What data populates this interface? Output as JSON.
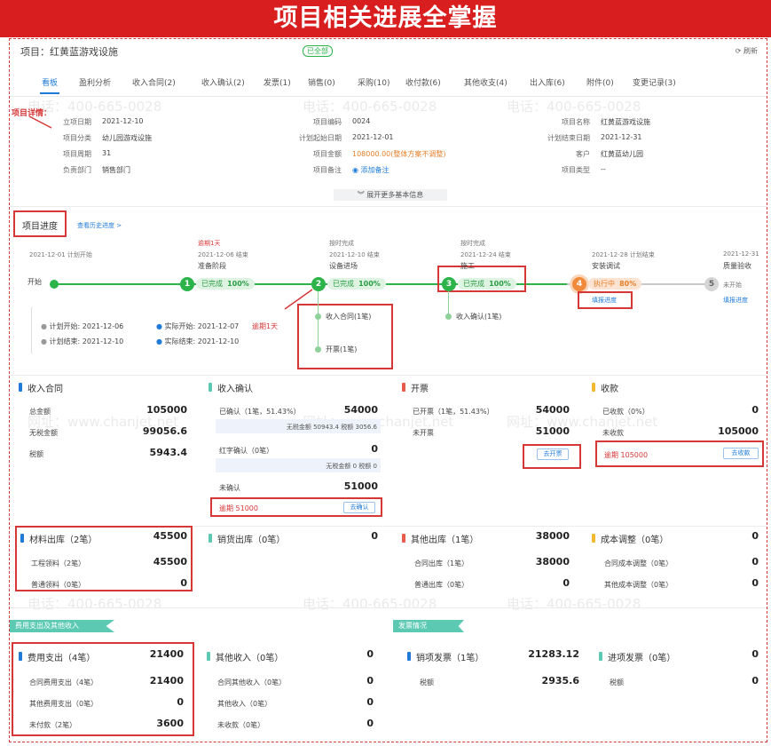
{
  "banner": "项目相关进展全掌握",
  "project": {
    "label": "项目：红黄蓝游戏设施",
    "status_tag": "已全部",
    "refresh": "刷新"
  },
  "tabs": [
    "看板",
    "盈利分析",
    "收入合同(2)",
    "收入确认(2)",
    "发票(1)",
    "销售(0)",
    "采购(10)",
    "收付款(6)",
    "其他收支(4)",
    "出入库(6)",
    "附件(0)",
    "变更记录(3)"
  ],
  "details": {
    "section_label": "项目详情：",
    "col1": [
      {
        "label": "立项日期",
        "value": "2021-12-10"
      },
      {
        "label": "项目分类",
        "value": "幼儿园游戏设施"
      },
      {
        "label": "项目周期",
        "value": "31"
      },
      {
        "label": "负责部门",
        "value": "销售部门"
      }
    ],
    "col2": [
      {
        "label": "项目编码",
        "value": "0024"
      },
      {
        "label": "计划起始日期",
        "value": "2021-12-01"
      },
      {
        "label": "项目金额",
        "value": "108000.00(整体方案不调整)"
      },
      {
        "label": "项目备注",
        "value": "◉ 添加备注"
      }
    ],
    "col3": [
      {
        "label": "项目名称",
        "value": "红黄蓝游戏设施"
      },
      {
        "label": "计划结束日期",
        "value": "2021-12-31"
      },
      {
        "label": "客户",
        "value": "红黄蓝幼儿园"
      },
      {
        "label": "项目类型",
        "value": "--"
      }
    ],
    "expand": "︾ 展开更多基本信息"
  },
  "progress": {
    "title": "项目进度",
    "history_link": "查看历史进度 >",
    "start_label": "开始",
    "start_sub": "2021-12-01 计划开始",
    "steps": [
      {
        "num": "1",
        "top": "逾期1天",
        "sub": "2021-12-06 结束",
        "name": "准备阶段",
        "status": "已完成",
        "pct": "100%"
      },
      {
        "num": "2",
        "top": "按时完成",
        "sub": "2021-12-10 结束",
        "name": "设备进场",
        "status": "已完成",
        "pct": "100%"
      },
      {
        "num": "3",
        "top": "按时完成",
        "sub": "2021-12-24 结束",
        "name": "施工",
        "status": "已完成",
        "pct": "100%"
      },
      {
        "num": "4",
        "top": "",
        "sub": "2021-12-28 计划结束",
        "name": "安装调试",
        "status": "执行中",
        "pct": "80%",
        "link": "填报进度"
      },
      {
        "num": "5",
        "top": "",
        "sub": "2021-12-31",
        "name": "质量验收",
        "status": "未开始",
        "pct": "",
        "link": "填报进度"
      }
    ],
    "plan_start": "计划开始: 2021-12-06",
    "actual_start": "实际开始: 2021-12-07",
    "overdue": "逾期1天",
    "plan_end": "计划结束: 2021-12-10",
    "actual_end": "实际结束: 2021-12-10",
    "sub2_a": "收入合同(1笔)",
    "sub2_b": "开票(1笔)",
    "sub3_a": "收入确认(1笔)"
  },
  "cards1": {
    "contract": {
      "title": "收入合同",
      "r1l": "总金额",
      "r1v": "105000",
      "r2l": "无税金额",
      "r2v": "99056.6",
      "r3l": "税额",
      "r3v": "5943.4"
    },
    "confirm": {
      "title": "收入确认",
      "r1l": "已确认（1笔，51.43%）",
      "r1v": "54000",
      "r1note": "无税金额 50943.4 税额 3056.6",
      "r2l": "红字确认（0笔）",
      "r2v": "0",
      "r2note": "无税金额 0 税额 0",
      "r3l": "未确认",
      "r3v": "51000",
      "overdue": "逾期 51000",
      "btn": "去确认"
    },
    "invoice": {
      "title": "开票",
      "r1l": "已开票（1笔，51.43%）",
      "r1v": "54000",
      "r2l": "未开票",
      "r2v": "51000",
      "btn": "去开票"
    },
    "receipt": {
      "title": "收款",
      "r1l": "已收款（0%）",
      "r1v": "0",
      "r2l": "未收款",
      "r2v": "105000",
      "overdue": "逾期 105000",
      "btn": "去收款"
    }
  },
  "cards2": {
    "material": {
      "title": "材料出库（2笔）",
      "v": "45500",
      "r1l": "工程领料（2笔）",
      "r1v": "45500",
      "r2l": "普通领料（0笔）",
      "r2v": "0"
    },
    "sales_out": {
      "title": "销货出库（0笔）",
      "v": "0"
    },
    "other_out": {
      "title": "其他出库（1笔）",
      "v": "38000",
      "r1l": "合同出库（1笔）",
      "r1v": "38000",
      "r2l": "普通出库（0笔）",
      "r2v": "0"
    },
    "cost_adj": {
      "title": "成本调整（0笔）",
      "v": "0",
      "r1l": "合同成本调整（0笔）",
      "r1v": "0",
      "r2l": "其他成本调整（0笔）",
      "r2v": "0"
    }
  },
  "ribbons": {
    "left": "费用支出及其他收入",
    "right": "发票情况"
  },
  "cards3": {
    "expense": {
      "title": "费用支出（4笔）",
      "v": "21400",
      "r1l": "合同费用支出（4笔）",
      "r1v": "21400",
      "r2l": "其他费用支出（0笔）",
      "r2v": "0",
      "r3l": "未付款（2笔）",
      "r3v": "3600"
    },
    "other_income": {
      "title": "其他收入（0笔）",
      "v": "0",
      "r1l": "合同其他收入（0笔）",
      "r1v": "0",
      "r2l": "其他收入（0笔）",
      "r2v": "0",
      "r3l": "未收款（0笔）",
      "r3v": "0"
    },
    "sales_invoice": {
      "title": "销项发票（1笔）",
      "v": "21283.12",
      "r1l": "税额",
      "r1v": "2935.6"
    },
    "input_invoice": {
      "title": "进项发票（0笔）",
      "v": "0",
      "r1l": "税额",
      "r1v": "0"
    }
  },
  "watermark": {
    "phone": "电话：400-665-0028",
    "site": "网址：www.chanjet.net"
  },
  "colors": {
    "banner": "#d81e1e",
    "blue": "#1f7bd8",
    "green": "#2cb34a",
    "orange": "#f08a3c",
    "teal": "#5cc9b3",
    "yellow": "#f2b830",
    "red": "#e85b4c"
  }
}
